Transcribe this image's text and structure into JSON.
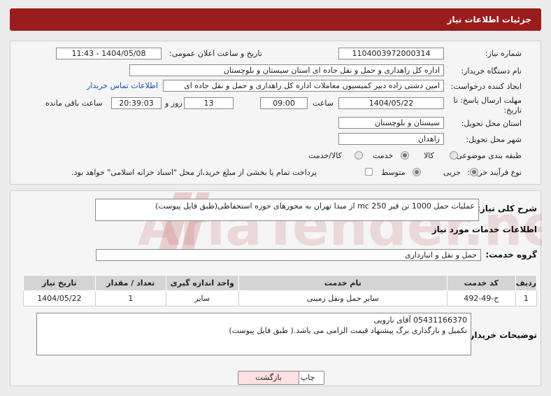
{
  "header": {
    "title": "جزئیات اطلاعات نیاز"
  },
  "form": {
    "need_number": {
      "label": "شماره نیاز:",
      "value": "1104003972000314"
    },
    "announce": {
      "label": "تاریخ و ساعت اعلان عمومی:",
      "value": "1404/05/08 - 11:43"
    },
    "buyer_org": {
      "label": "نام دستگاه خریدار:",
      "value": "اداره کل راهداری و حمل و نقل جاده ای استان سیستان و بلوچستان"
    },
    "requester": {
      "label": "ایجاد کننده درخواست:",
      "value": "امین دشتی زاده دبیر کمیسیون معاملات اداره کل راهداری و حمل و نقل جاده ای",
      "contact_link": "اطلاعات تماس خریدار"
    },
    "deadline": {
      "label": "مهلت ارسال پاسخ: تا تاریخ:",
      "date": "1404/05/22",
      "time_label": "ساعت",
      "time": "09:00",
      "days": "13",
      "days_label": "روز و",
      "remaining": "20:39:03",
      "remaining_label": "ساعت باقی مانده"
    },
    "province": {
      "label": "استان محل تحویل:",
      "value": "سیستان و بلوچستان"
    },
    "city": {
      "label": "شهر محل تحویل:",
      "value": "زاهدان"
    },
    "category": {
      "label": "طبقه بندی موضوعی:",
      "options": [
        "کالا",
        "خدمت",
        "کالا/خدمت"
      ],
      "selected": "خدمت"
    },
    "process": {
      "label": "نوع فرآیند خرید :",
      "options": [
        "جزیی",
        "متوسط"
      ],
      "selected": "جزیی",
      "payment_note": "پرداخت تمام یا بخشی از مبلغ خرید،از محل \"اسناد خزانه اسلامی\" خواهد بود."
    }
  },
  "description": {
    "label": "شرح کلی نیاز:",
    "value": "عملیات حمل 1000 تن قیر mc 250 از مبدا تهران به محورهای حوزه استحفاظی(طبق فایل پیوست)"
  },
  "services": {
    "title": "اطلاعات خدمات مورد نیاز",
    "group_label": "گروه خدمت:",
    "group_value": "حمل و نقل و انبارداری",
    "columns": [
      "ردیف",
      "کد خدمت",
      "نام خدمت",
      "واحد اندازه گیری",
      "تعداد / مقدار",
      "تاریخ نیاز"
    ],
    "rows": [
      {
        "row": "1",
        "code": "ح-49-492",
        "name": "سایر حمل ونقل زمینی",
        "unit": "سایر",
        "qty": "1",
        "date": "1404/05/22"
      }
    ]
  },
  "buyer_notes": {
    "label": "توضیحات خریدار:",
    "line1": "05431166370 آقای نارویی",
    "line2": "تکمیل و بارگذاری برگ پیشنهاد قیمت الزامی می باشد.( طبق فایل پیوست)"
  },
  "buttons": {
    "print": "چاپ",
    "back": "بازگشت"
  },
  "watermark": {
    "text": "AriaTender.neT"
  },
  "colors": {
    "header": "#9b1c1c",
    "link": "#1a4fb4",
    "back_button": "#fde0e0"
  }
}
